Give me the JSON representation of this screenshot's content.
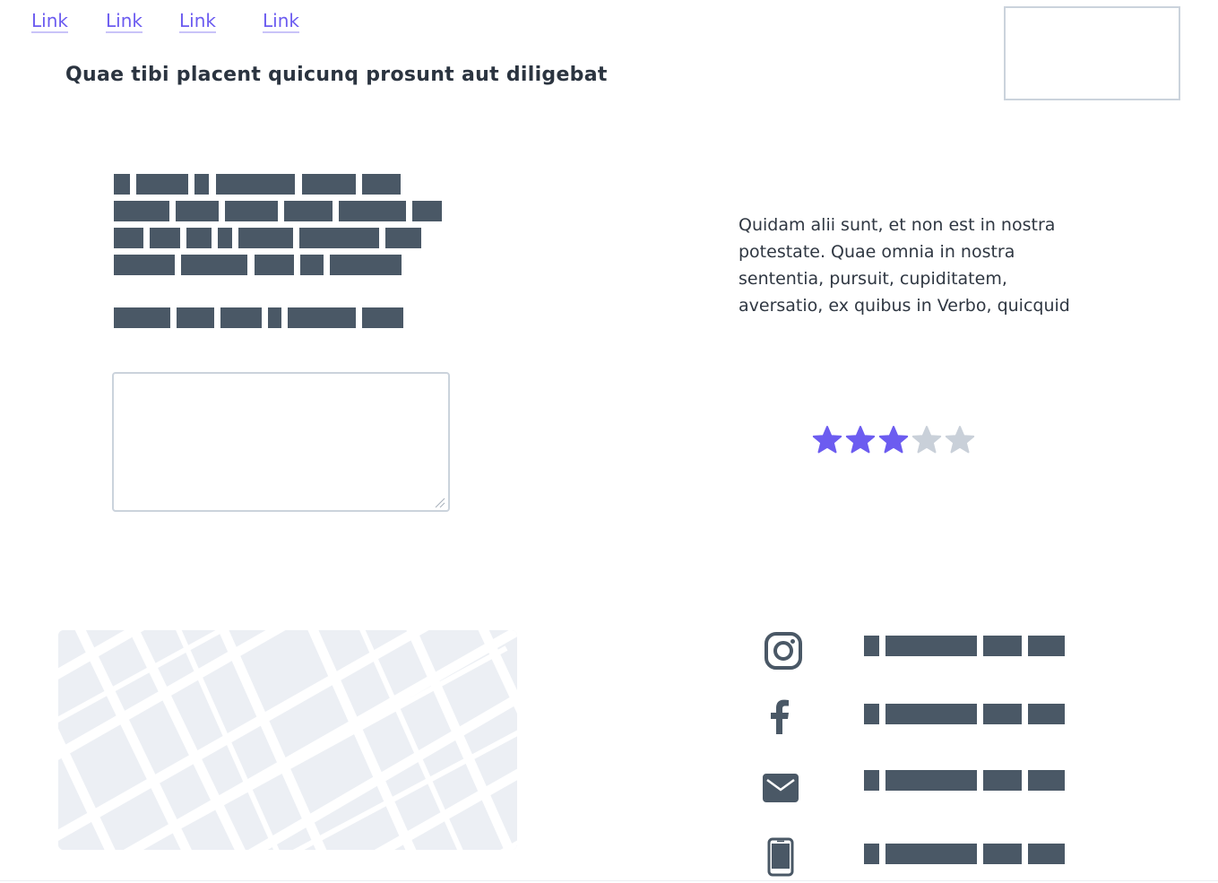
{
  "nav": {
    "links": [
      "Link",
      "Link",
      "Link",
      "Link"
    ]
  },
  "header": {
    "title": "Quae tibi placent quicunq prosunt aut diligebat"
  },
  "intro": {
    "paragraph": "Quidam alii sunt, et non est in nostra potestate. Quae omnia in nostra sententia, pursuit, cupiditatem, aversatio, ex quibus in Verbo, quicquid"
  },
  "message": {
    "value": "",
    "placeholder": ""
  },
  "rating": {
    "value": 3,
    "max": 5,
    "active_color": "#6c5cf0",
    "inactive_color": "#c9d0d9"
  },
  "contacts": [
    {
      "icon": "instagram-icon"
    },
    {
      "icon": "facebook-icon"
    },
    {
      "icon": "mail-icon"
    },
    {
      "icon": "phone-icon"
    }
  ],
  "colors": {
    "accent": "#6c5cf0",
    "placeholder_bar": "#4a5866",
    "text": "#2b3440"
  }
}
